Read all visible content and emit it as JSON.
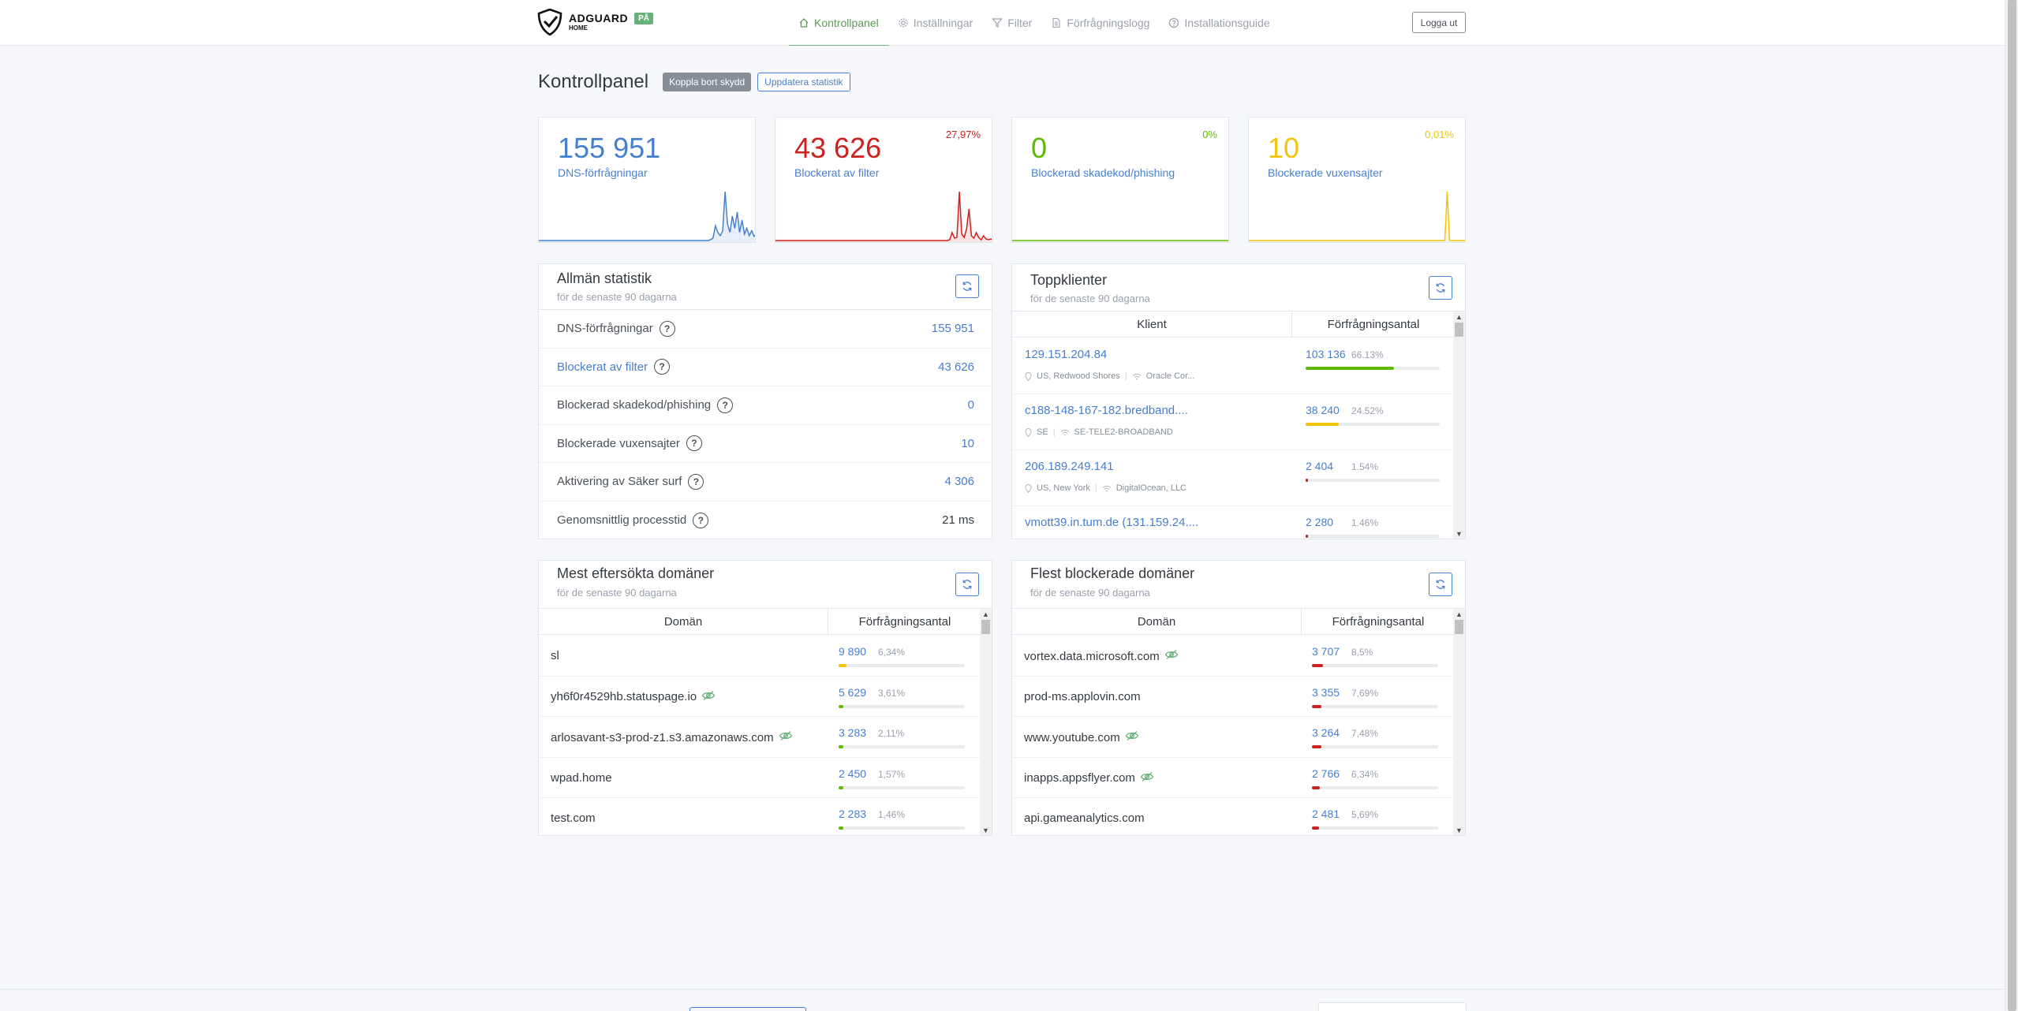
{
  "header": {
    "brand": "ADGUARD",
    "brand_sub": "HOME",
    "status_badge": "PÅ",
    "nav": [
      {
        "label": "Kontrollpanel",
        "icon": "home-icon"
      },
      {
        "label": "Inställningar",
        "icon": "gear-icon"
      },
      {
        "label": "Filter",
        "icon": "filter-icon"
      },
      {
        "label": "Förfrågningslogg",
        "icon": "document-icon"
      },
      {
        "label": "Installationsguide",
        "icon": "help-circle-icon"
      }
    ],
    "logout": "Logga ut"
  },
  "page": {
    "title": "Kontrollpanel",
    "disable_protection": "Koppla bort skydd",
    "refresh_stats": "Uppdatera statistik"
  },
  "cards": [
    {
      "value": "155 951",
      "label": "DNS-förfrågningar",
      "percent": "",
      "color": "#467fcf"
    },
    {
      "value": "43 626",
      "label": "Blockerat av filter",
      "percent": "27,97%",
      "color": "#cd201f"
    },
    {
      "value": "0",
      "label": "Blockerad skadekod/phishing",
      "percent": "0%",
      "color": "#5eba00"
    },
    {
      "value": "10",
      "label": "Blockerade vuxensajter",
      "percent": "0,01%",
      "color": "#f1c40f"
    }
  ],
  "general_stats": {
    "title": "Allmän statistik",
    "subtitle": "för de senaste 90 dagarna",
    "rows": [
      {
        "label": "DNS-förfrågningar",
        "value": "155 951"
      },
      {
        "label": "Blockerat av filter",
        "value": "43 626"
      },
      {
        "label": "Blockerad skadekod/phishing",
        "value": "0"
      },
      {
        "label": "Blockerade vuxensajter",
        "value": "10"
      },
      {
        "label": "Aktivering av Säker surf",
        "value": "4 306"
      },
      {
        "label": "Genomsnittlig processtid",
        "value": "21 ms"
      }
    ]
  },
  "top_clients": {
    "title": "Toppklienter",
    "subtitle": "för de senaste 90 dagarna",
    "col_client": "Klient",
    "col_count": "Förfrågningsantal",
    "rows": [
      {
        "name": "129.151.204.84",
        "ip": "",
        "location": "US, Redwood Shores",
        "org": "Oracle Cor...",
        "count": "103 136",
        "percent": "66.13%",
        "fill": 0.6613,
        "color": "#5eba00"
      },
      {
        "name": "c188-148-167-182.bredband....",
        "ip": "",
        "location": "SE",
        "org": "SE-TELE2-BROADBAND",
        "count": "38 240",
        "percent": "24.52%",
        "fill": 0.2452,
        "color": "#f1c40f"
      },
      {
        "name": "206.189.249.141",
        "ip": "",
        "location": "US, New York",
        "org": "DigitalOcean, LLC",
        "count": "2 404",
        "percent": "1.54%",
        "fill": 0.0154,
        "color": "#cd201f"
      },
      {
        "name": "vmott39.in.tum.de",
        "ip": "(131.159.24....",
        "location": "",
        "org": "",
        "count": "2 280",
        "percent": "1.46%",
        "fill": 0.0146,
        "color": "#cd201f"
      }
    ]
  },
  "top_domains": {
    "title": "Mest eftersökta domäner",
    "subtitle": "för de senaste 90 dagarna",
    "col_domain": "Domän",
    "col_count": "Förfrågningsantal",
    "rows": [
      {
        "name": "sl",
        "eye": false,
        "count": "9 890",
        "percent": "6,34%",
        "fill": 0.0634,
        "color": "#f1c40f"
      },
      {
        "name": "yh6f0r4529hb.statuspage.io",
        "eye": true,
        "count": "5 629",
        "percent": "3,61%",
        "fill": 0.0361,
        "color": "#5eba00"
      },
      {
        "name": "arlosavant-s3-prod-z1.s3.amazonaws.com",
        "eye": true,
        "count": "3 283",
        "percent": "2,11%",
        "fill": 0.0211,
        "color": "#5eba00"
      },
      {
        "name": "wpad.home",
        "eye": false,
        "count": "2 450",
        "percent": "1,57%",
        "fill": 0.0157,
        "color": "#5eba00"
      },
      {
        "name": "test.com",
        "eye": false,
        "count": "2 283",
        "percent": "1,46%",
        "fill": 0.0146,
        "color": "#5eba00"
      }
    ]
  },
  "top_blocked": {
    "title": "Flest blockerade domäner",
    "subtitle": "för de senaste 90 dagarna",
    "col_domain": "Domän",
    "col_count": "Förfrågningsantal",
    "rows": [
      {
        "name": "vortex.data.microsoft.com",
        "eye": true,
        "count": "3 707",
        "percent": "8,5%",
        "fill": 0.085,
        "color": "#cd201f"
      },
      {
        "name": "prod-ms.applovin.com",
        "eye": false,
        "count": "3 355",
        "percent": "7,69%",
        "fill": 0.0769,
        "color": "#cd201f"
      },
      {
        "name": "www.youtube.com",
        "eye": true,
        "count": "3 264",
        "percent": "7,48%",
        "fill": 0.0748,
        "color": "#cd201f"
      },
      {
        "name": "inapps.appsflyer.com",
        "eye": true,
        "count": "2 766",
        "percent": "6,34%",
        "fill": 0.0634,
        "color": "#cd201f"
      },
      {
        "name": "api.gameanalytics.com",
        "eye": false,
        "count": "2 481",
        "percent": "5,69%",
        "fill": 0.0569,
        "color": "#cd201f"
      }
    ]
  }
}
